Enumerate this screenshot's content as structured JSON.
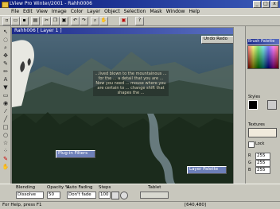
{
  "window": {
    "title": "LView Pro Winter/2001 - Rahh0006"
  },
  "window_buttons": [
    "_",
    "□",
    "x"
  ],
  "menu": [
    "File",
    "Edit",
    "View",
    "Image",
    "Color",
    "Layer",
    "Object",
    "Selection",
    "Mask",
    "Window",
    "Help"
  ],
  "toolbar_icons": [
    "new-icon",
    "open-icon",
    "save-icon",
    "print-icon",
    "cut-icon",
    "copy-icon",
    "paste-icon",
    "undo-icon",
    "redo-icon",
    "zoom-icon",
    "hand-icon",
    "red-tool-icon",
    "help-icon"
  ],
  "left_tools": [
    "arrow-tool",
    "lasso-tool",
    "zoom-tool",
    "move-tool",
    "brush-tool",
    "pencil-tool",
    "text-tool",
    "fill-tool",
    "eraser-tool",
    "clone-tool",
    "dropper-tool",
    "line-tool",
    "rect-tool",
    "ellipse-tool",
    "star-tool",
    "spray-tool",
    "red-brush-tool",
    "hand-tool"
  ],
  "image_window": {
    "title": "Rahh006 [ Layer 1 ]"
  },
  "panels": {
    "undo": "Undo Redo",
    "plugin_filters": "Plug-in Filters",
    "layer_palette": "Layer Palette",
    "brush_palette": "Brush Palette",
    "styles": "Styles",
    "textures": "Textures",
    "lock": "Lock"
  },
  "info_text": "...lived blown to the mountainous ... for the ... a detail that you are ... Now you need ... mouse where you are certain to ... change shift that shapes the ...",
  "right_values": {
    "r": "255",
    "g": "255",
    "b": "255"
  },
  "bottom": {
    "blending_label": "Blending",
    "blending_value": "Dissolve",
    "opacity_label": "Opacity %",
    "opacity_value": "50",
    "auto_fading_label": "Auto Fading",
    "auto_fading_value": "Don't fade",
    "steps_label": "Steps",
    "steps_value": "100",
    "tablet_label": "Tablet"
  },
  "status": {
    "help": "For Help, press F1",
    "coords": "[640,480]"
  }
}
